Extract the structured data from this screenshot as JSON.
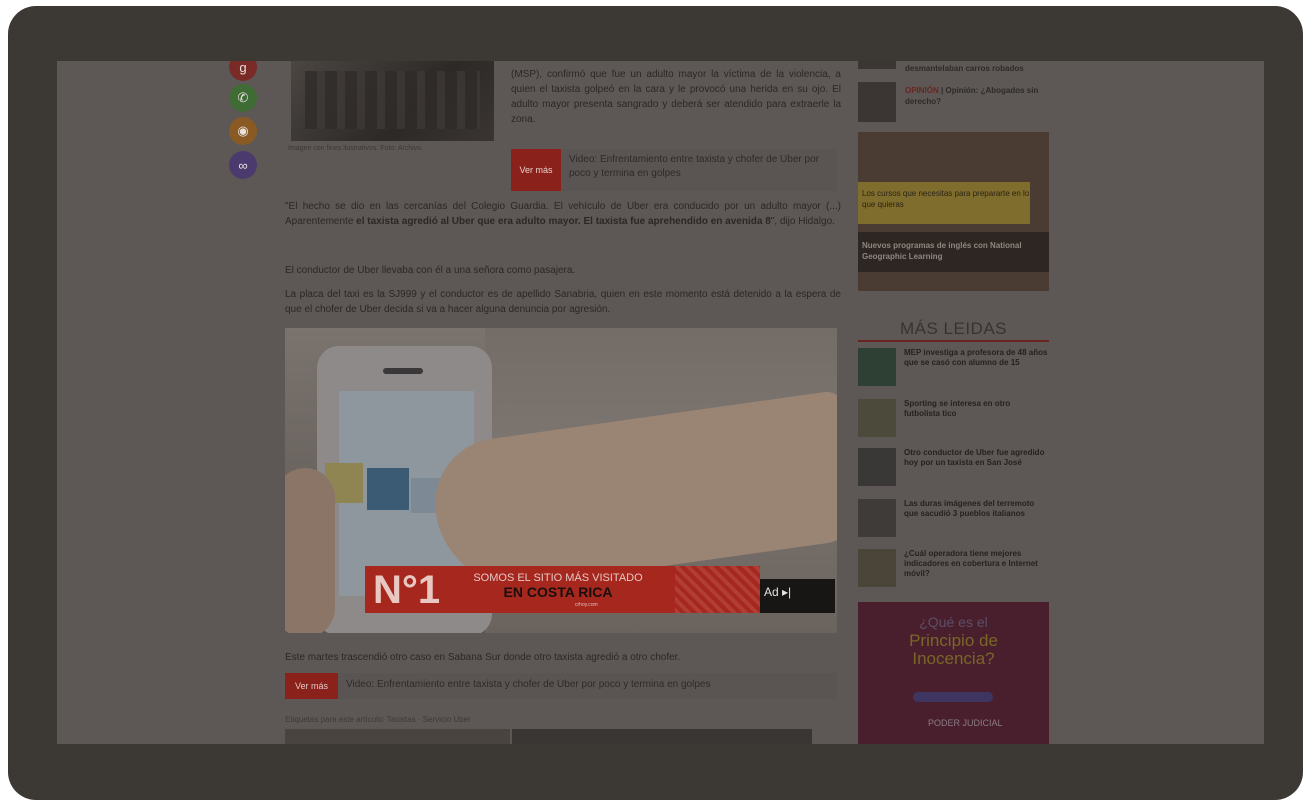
{
  "share_icons": [
    "google-plus-icon",
    "whatsapp-icon",
    "rss-icon",
    "link-icon"
  ],
  "article": {
    "photo_caption": "Imagen con fines ilustrativos. Foto: Archivo.",
    "lead": "(MSP), confirmó que fue un adulto mayor la víctima de la violencia, a quien el taxista golpeó en la cara y le provocó una herida en su ojo. El adulto mayor presenta sangrado y deberá ser atendido para extraerle la zona.",
    "vermas_label": "Ver más",
    "vermas_text": "Video: Enfrentamiento entre taxista y chofer de Uber por poco y termina en golpes",
    "para1_plain": "\"El hecho se dio en las cercanías del Colegio Guardia. El vehículo de Uber era conducido por un adulto mayor (...) Aparentemente ",
    "para1_bold": "el taxista agredió al Uber que era adulto mayor. El taxista fue aprehendido en avenida 8",
    "para1_end": "\", dijo Hidalgo.",
    "para2": "El conductor de Uber llevaba con él a una señora como pasajera.",
    "para3": "La placa del taxi es la SJ999 y el conductor es de apellido Sanabria, quien en este momento está detenido a la espera de que el chofer de Uber decida si va a hacer alguna denuncia por agresión.",
    "after_video": "Este martes trascendió otro caso en Sabana Sur donde otro taxista agredió a otro chofer.",
    "vermas2_label": "Ver más",
    "vermas2_text": "Video: Enfrentamiento entre taxista y chofer de Uber por poco y termina en golpes",
    "tags": "Etiquetas para este artículo: Taxistas · Servicio Uber"
  },
  "video_ad": {
    "n1": "N°1",
    "line1": "SOMOS EL SITIO MÁS VISITADO",
    "line2": "EN COSTA RICA",
    "tag": "crhoy.com",
    "ad_label": "Ad ▸|"
  },
  "sidebar": {
    "top_item1": "desmantelaban carros robados",
    "top_item2_highlight": "OPINIÓN",
    "top_item2": "| Opinión: ¿Abogados sin derecho?",
    "ad1_text1": "Los cursos que necesitas para prepararte en lo que quieras",
    "ad1_text2": "Nuevos programas de inglés con National Geographic Learning",
    "mas_leidas_title": "MÁS LEIDAS",
    "mas_leidas": [
      "MEP investiga a profesora de 48 años que se casó con alumno de 15",
      "Sporting se interesa en otro futbolista tico",
      "Otro conductor de Uber fue agredido hoy por un taxista en San José",
      "Las duras imágenes del terremoto que sacudió 3 pueblos italianos",
      "¿Cuál operadora tiene mejores indicadores en cobertura e Internet móvil?"
    ],
    "ad2_q": "¿Qué es el",
    "ad2_main1": "Principio de",
    "ad2_main2": "Inocencia?",
    "ad2_logo": "PODER JUDICIAL"
  },
  "colors": {
    "bezel": "#3c3935",
    "overlay": "#5d5855",
    "accent": "#8b211b"
  }
}
